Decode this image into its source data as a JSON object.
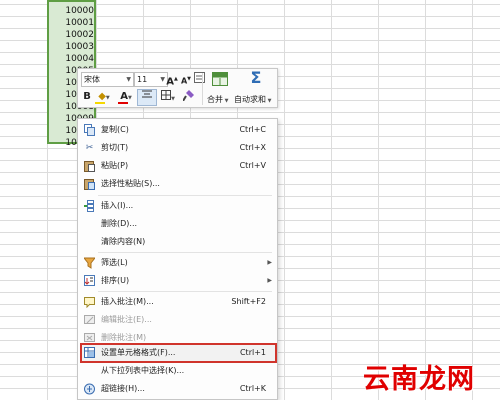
{
  "sheet": {
    "cell_values": [
      "10000",
      "10001",
      "10002",
      "10003",
      "10004",
      "10005",
      "10006",
      "10007",
      "10008",
      "10009",
      "10010",
      "10011"
    ],
    "accent_selection": "#d9ead3",
    "selection_border": "#5f9e44"
  },
  "mini_toolbar": {
    "font_name": "宋体",
    "font_size": "11",
    "grow_font": "A",
    "shrink_font": "A",
    "bold": "B",
    "font_color_letter": "A",
    "merge_label": "合并",
    "autosum_label": "自动求和",
    "autosum_symbol": "Σ"
  },
  "context_menu": {
    "items": [
      {
        "label": "复制(C)",
        "shortcut": "Ctrl+C",
        "icon": "copy-icon"
      },
      {
        "label": "剪切(T)",
        "shortcut": "Ctrl+X",
        "icon": "scissors-icon"
      },
      {
        "label": "粘贴(P)",
        "shortcut": "Ctrl+V",
        "icon": "paste-icon"
      },
      {
        "label": "选择性粘贴(S)...",
        "shortcut": "",
        "icon": "paste-special-icon"
      },
      {
        "label": "插入(I)...",
        "shortcut": "",
        "icon": "insert-icon"
      },
      {
        "label": "删除(D)...",
        "shortcut": "",
        "icon": ""
      },
      {
        "label": "清除内容(N)",
        "shortcut": "",
        "icon": ""
      },
      {
        "label": "筛选(L)",
        "shortcut": "",
        "icon": "filter-icon"
      },
      {
        "label": "排序(U)",
        "shortcut": "",
        "icon": "sort-icon"
      },
      {
        "label": "插入批注(M)...",
        "shortcut": "Shift+F2",
        "icon": "comment-icon"
      },
      {
        "label": "编辑批注(E)...",
        "shortcut": "",
        "icon": "edit-comment-icon"
      },
      {
        "label": "删除批注(M)",
        "shortcut": "",
        "icon": "delete-comment-icon"
      },
      {
        "label": "设置单元格格式(F)...",
        "shortcut": "Ctrl+1",
        "icon": "format-cells-icon"
      },
      {
        "label": "从下拉列表中选择(K)...",
        "shortcut": "",
        "icon": ""
      },
      {
        "label": "超链接(H)...",
        "shortcut": "Ctrl+K",
        "icon": "hyperlink-icon"
      }
    ],
    "highlight_color": "#d0342c"
  },
  "watermark": "云南龙网"
}
